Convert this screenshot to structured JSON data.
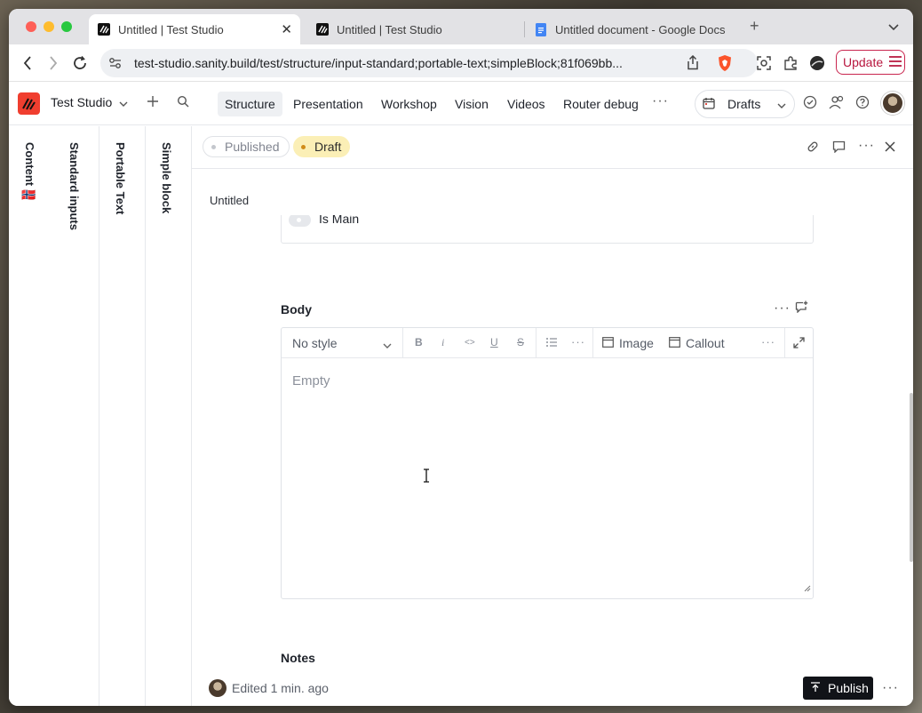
{
  "browser": {
    "tabs": [
      {
        "title": "Untitled | Test Studio",
        "active": true
      },
      {
        "title": "Untitled | Test Studio",
        "active": false
      },
      {
        "title": "Untitled document - Google Docs",
        "active": false
      }
    ],
    "url": "test-studio.sanity.build/test/structure/input-standard;portable-text;simpleBlock;81f069bb...",
    "update_label": "Update",
    "brave_color": "#fb542b"
  },
  "studio": {
    "workspace_name": "Test Studio",
    "menu": [
      "Structure",
      "Presentation",
      "Workshop",
      "Vision",
      "Videos",
      "Router debug"
    ],
    "active_menu": "Structure",
    "perspective_label": "Drafts",
    "brand_color": "#f03e2f"
  },
  "panes": [
    "Content 🇳🇴",
    "Standard inputs",
    "Portable Text",
    "Simple block"
  ],
  "document": {
    "published_label": "Published",
    "draft_label": "Draft",
    "title": "Untitled",
    "is_main_label": "Is Main",
    "body_label": "Body",
    "style_select": "No style",
    "toolbar": {
      "bold": "B",
      "italic": "i",
      "code": "<>",
      "underline": "U",
      "strike": "S",
      "image_label": "Image",
      "callout_label": "Callout"
    },
    "editor_placeholder": "Empty",
    "notes_label": "Notes"
  },
  "footer": {
    "edited_text": "Edited 1 min. ago",
    "publish_label": "Publish"
  }
}
